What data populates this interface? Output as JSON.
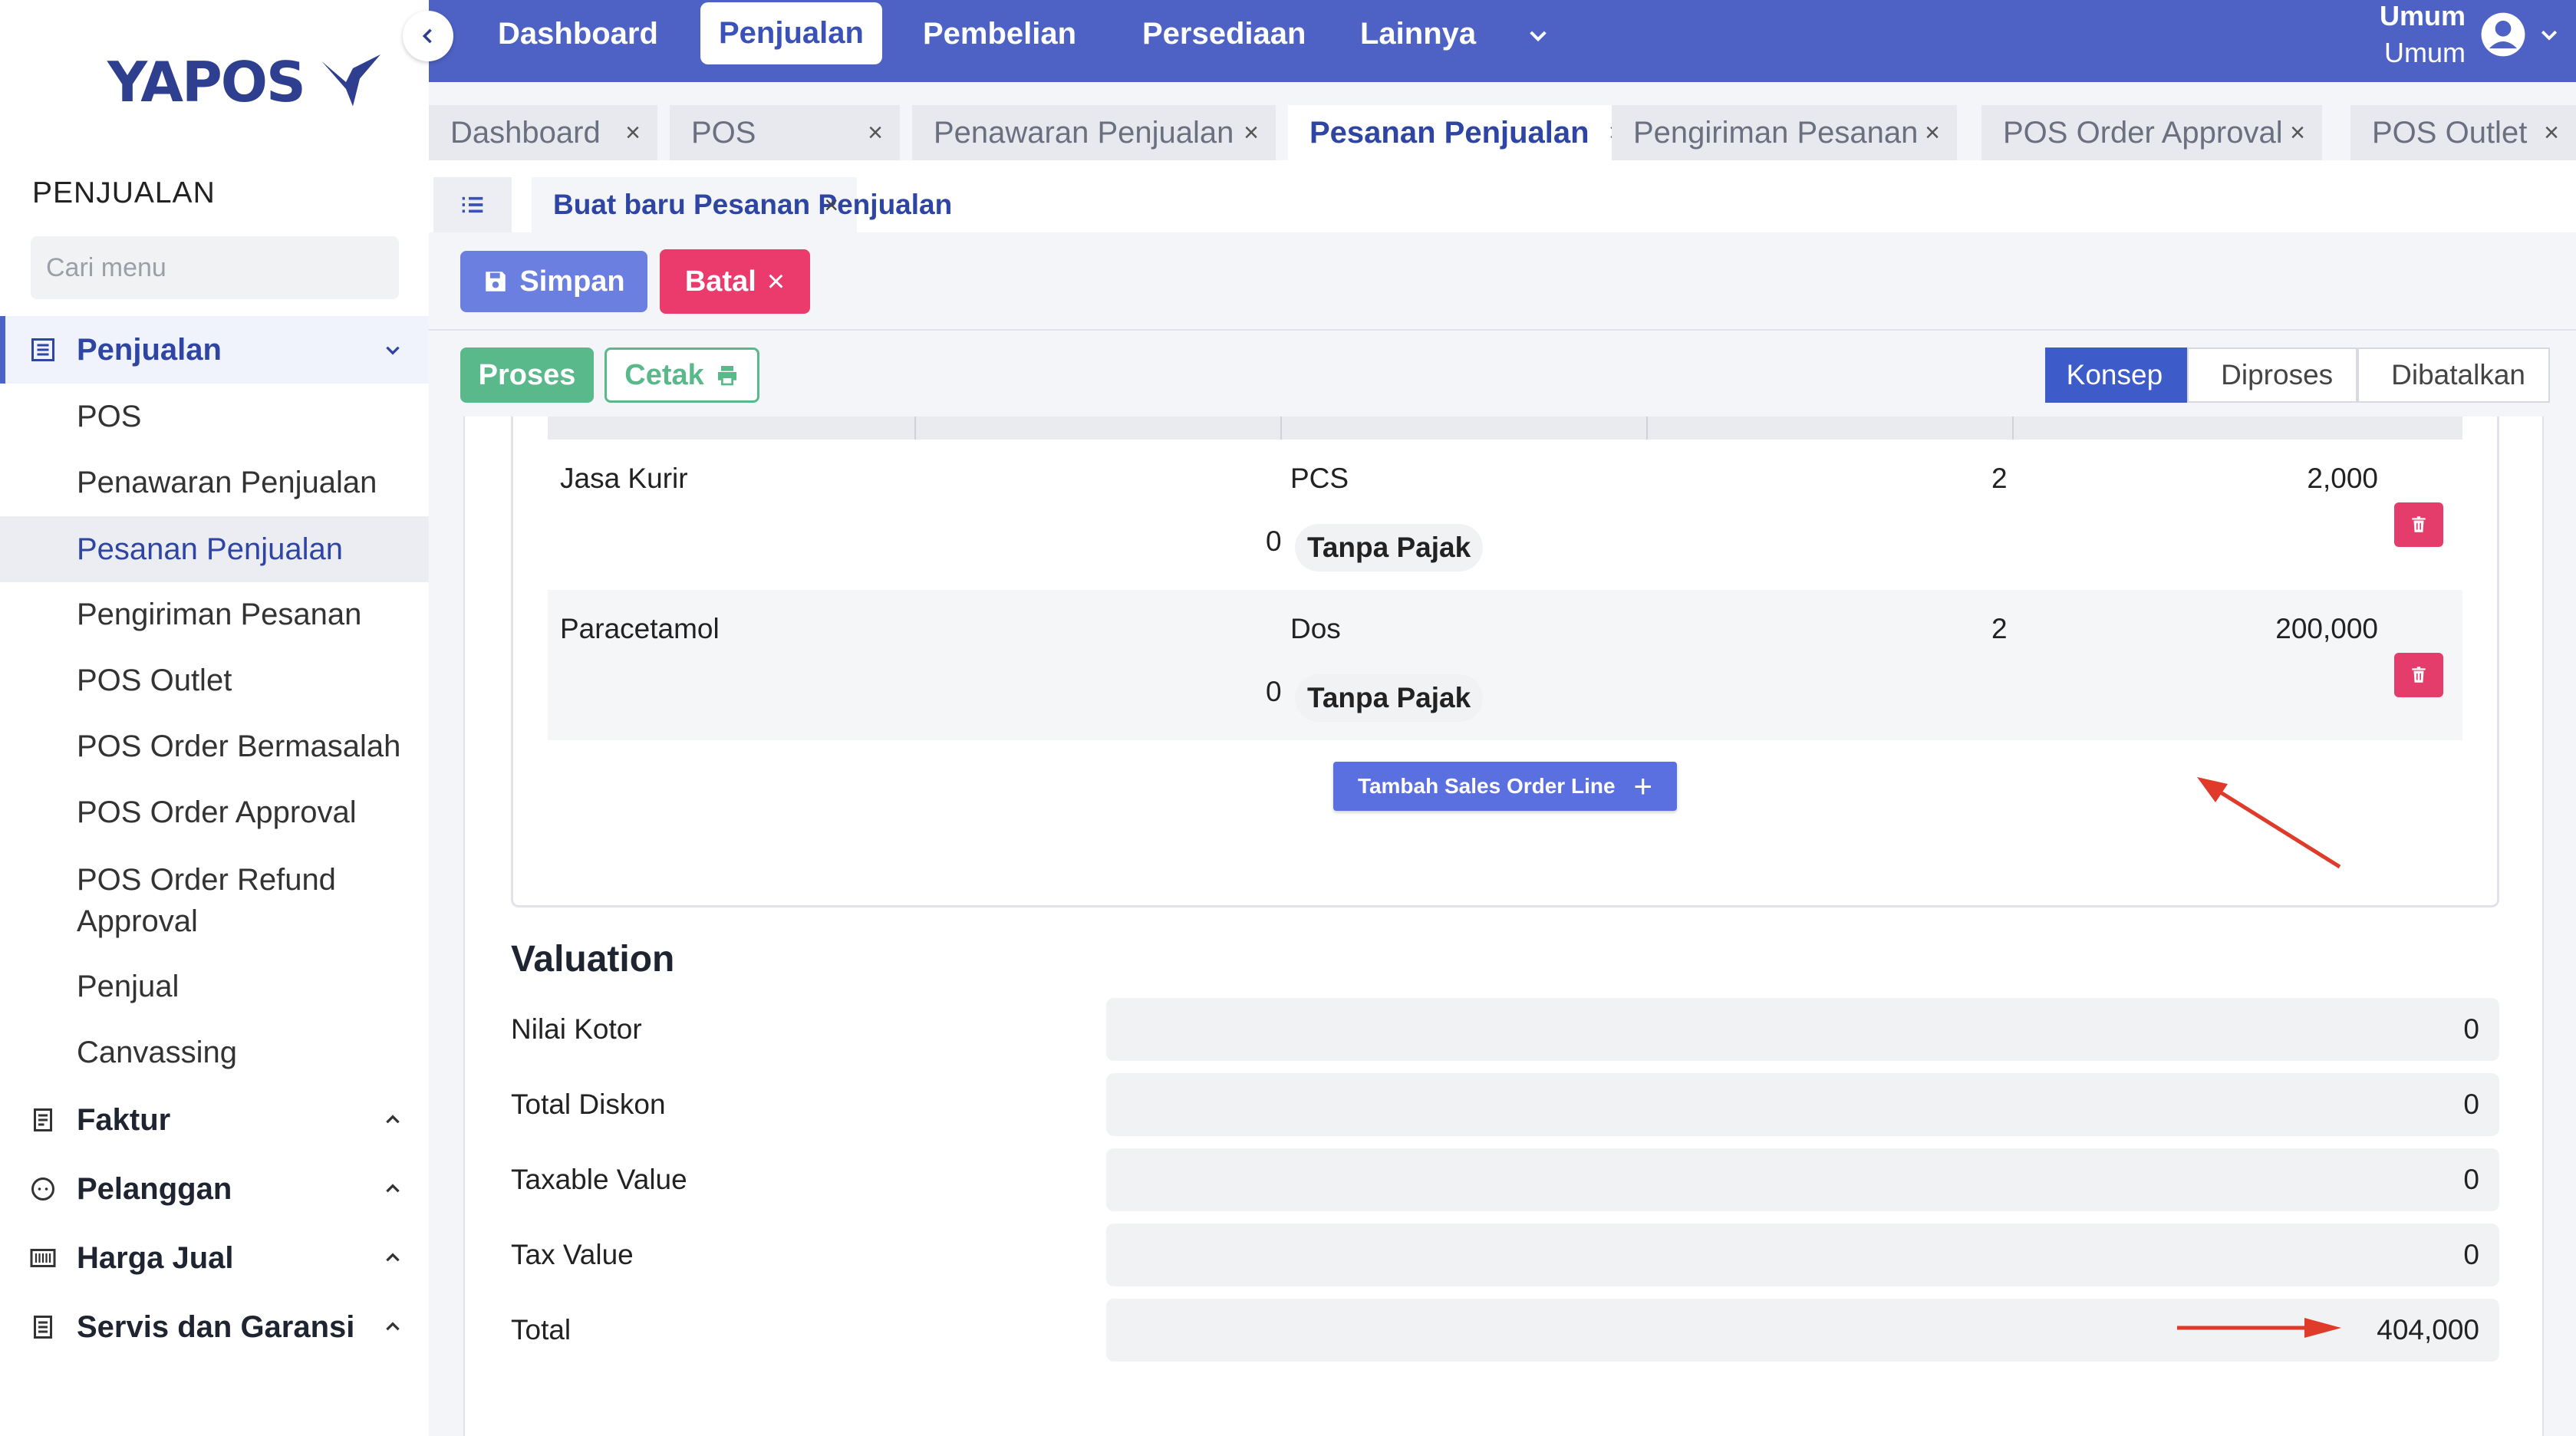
{
  "app": {
    "logo_text": "YAPOS"
  },
  "sidebar": {
    "section_title": "PENJUALAN",
    "search_placeholder": "Cari menu",
    "groups": [
      {
        "label": "Penjualan",
        "icon": "list-icon"
      },
      {
        "label": "Faktur",
        "icon": "receipt-icon"
      },
      {
        "label": "Pelanggan",
        "icon": "face-icon"
      },
      {
        "label": "Harga Jual",
        "icon": "barcode-icon"
      },
      {
        "label": "Servis dan Garansi",
        "icon": "document-icon"
      }
    ],
    "items": [
      "POS",
      "Penawaran Penjualan",
      "Pesanan Penjualan",
      "Pengiriman Pesanan",
      "POS Outlet",
      "POS Order Bermasalah",
      "POS Order Approval",
      "POS Order Refund Approval",
      "Penjual",
      "Canvassing"
    ],
    "selected_item": "Pesanan Penjualan"
  },
  "topnav": {
    "items": [
      "Dashboard",
      "Penjualan",
      "Pembelian",
      "Persediaan",
      "Lainnya"
    ],
    "active": "Penjualan",
    "user_line1": "Umum",
    "user_line2": "Umum"
  },
  "tabs": [
    "Dashboard",
    "POS",
    "Penawaran Penjualan",
    "Pesanan Penjualan",
    "Pengiriman Pesanan",
    "POS Order Approval",
    "POS Outlet"
  ],
  "active_tab": "Pesanan Penjualan",
  "subtab": {
    "label": "Buat baru Pesanan Penjualan"
  },
  "actions": {
    "save": "Simpan",
    "cancel": "Batal",
    "process": "Proses",
    "print": "Cetak"
  },
  "status_steps": [
    "Konsep",
    "Diproses",
    "Dibatalkan"
  ],
  "active_step": "Konsep",
  "lines": [
    {
      "product": "Jasa Kurir",
      "uom": "PCS",
      "qty": "2",
      "price": "2,000",
      "discount": "0",
      "tax": "Tanpa Pajak"
    },
    {
      "product": "Paracetamol",
      "uom": "Dos",
      "qty": "2",
      "price": "200,000",
      "discount": "0",
      "tax": "Tanpa Pajak"
    }
  ],
  "add_line_label": "Tambah Sales Order Line",
  "valuation": {
    "title": "Valuation",
    "rows": [
      {
        "label": "Nilai Kotor",
        "value": "0"
      },
      {
        "label": "Total Diskon",
        "value": "0"
      },
      {
        "label": "Taxable Value",
        "value": "0"
      },
      {
        "label": "Tax Value",
        "value": "0"
      },
      {
        "label": "Total",
        "value": "404,000"
      }
    ]
  },
  "colors": {
    "primary": "#4d62c4",
    "danger": "#eb3b6c",
    "success": "#59b98a",
    "annotation": "#e03a2a"
  }
}
